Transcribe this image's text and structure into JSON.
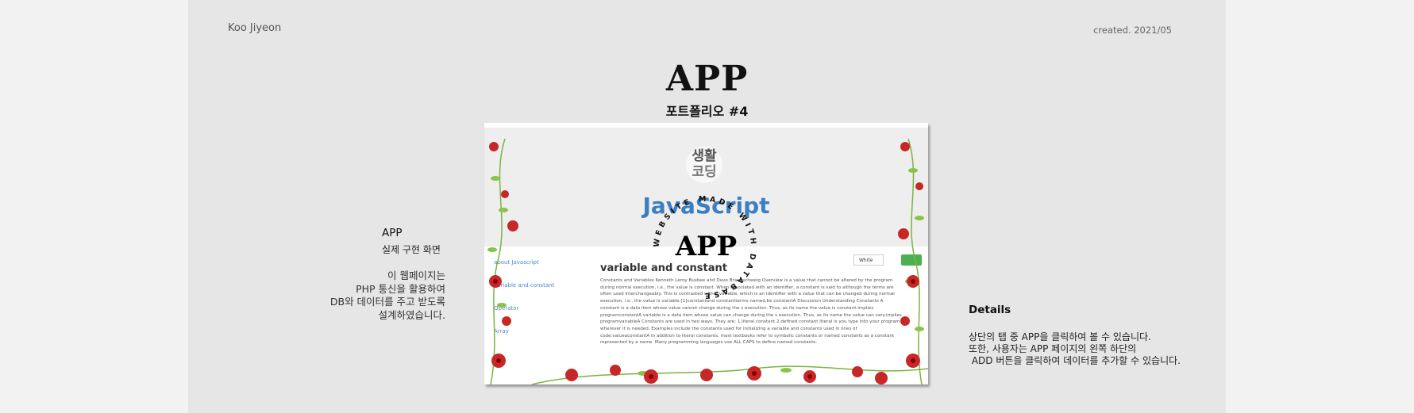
{
  "header": {
    "author": "Koo Jiyeon",
    "created": "created. 2021/05",
    "title": "APP",
    "subtitle": "포트폴리오 #4"
  },
  "left": {
    "heading": "APP",
    "subheading": "실제 구현 화면",
    "description": [
      "이 웹페이지는",
      "PHP 통신을 활용하여",
      "DB와 데이터를 주고 받도록",
      "설계하였습니다."
    ]
  },
  "right": {
    "heading": "Details",
    "lines": [
      "상단의 탭 중 APP을 클릭하여 볼 수 있습니다.",
      "",
      "또한, 사용자는 APP 페이지의 왼쪽 하단의",
      " ADD 버튼을 클릭하여 데이터를 추가할 수 있습니다."
    ]
  },
  "screenshot": {
    "logo_line1": "생활",
    "logo_line2": "코딩",
    "site_title": "JavaScript",
    "overlay_app": "APP",
    "circle_text": "WEBSITE MADE WITH DATABASE",
    "nav": [
      "about Javascript",
      "variable and constant",
      "Operator",
      "Array"
    ],
    "content_title": "variable and constant",
    "content_body": "Constants and Variables Kenneth Leroy Busbee and Dave Braunschweig Overview is a value that cannot be altered by the program during normal execution, i.e., the value is constant. When associated with an identifier, a constant is said to although the terms are often used interchangeably. This is contrasted with a variable, which is an identifier with a value that can be changed during normal execution, i.e., the value is variable.[1]constantand constantterms named,be constantA Discussion Understanding Constants A constant is a data item whose value cannot change during the s execution. Thus, as its name the value is constant.implies programconstantA variable is a data item whose value can change during the s execution. Thus, as its name the value can vary.implies programvariableA Constants are used in two ways. They are: 1.literal constant 2.defined constant literal is you type into your program wherever it is needed. Examples include the constants used for initializing a variable and constants used in lines of code:valueaconstantA In addition to literal constants, most textbooks refer to symbolic constants or named constants as a constant represented by a name. Many programming languages use ALL CAPS to define named constants.",
    "mode_button": "White"
  },
  "colors": {
    "panel": "#e6e6e6",
    "outer": "#f2f2f2",
    "js_blue": "#3b7fc1",
    "green": "#4caf50",
    "rose": "#c62828"
  }
}
